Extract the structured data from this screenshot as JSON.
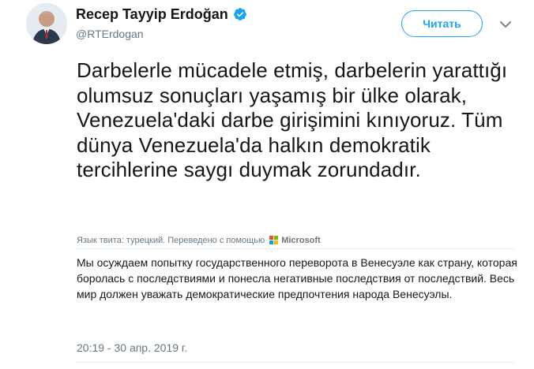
{
  "author": {
    "display_name": "Recep Tayyip Erdoğan",
    "handle": "@RTErdogan",
    "verified": true,
    "avatar_icon": "profile-photo"
  },
  "follow_button": {
    "label": "Читать"
  },
  "menu": {
    "icon": "chevron-down-icon"
  },
  "tweet": {
    "text": "Darbelerle mücadele etmiş, darbelerin yarattığı olumsuz sonuçları yaşamış bir ülke olarak, Venezuela'daki darbe girişimini kınıyoruz. Tüm dünya Venezuela'da halkın demokratik tercihlerine saygı duymak zorundadır.",
    "translation_meta": "Язык твита: турецкий. Переведено с помощью",
    "translator_name": "Microsoft",
    "translation": "Мы осуждаем попытку государственного переворота в Венесуэле как страну, которая боролась с последствиями и понесла негативные последствия от последствий. Весь мир должен уважать демократические предпочтения народа Венесуэлы.",
    "timestamp": "20:19 - 30 апр. 2019 г."
  },
  "colors": {
    "accent": "#1da1f2",
    "muted": "#657786",
    "text": "#14171a",
    "ms_red": "#f25022",
    "ms_green": "#7fba00",
    "ms_blue": "#00a4ef",
    "ms_yellow": "#ffb900"
  }
}
